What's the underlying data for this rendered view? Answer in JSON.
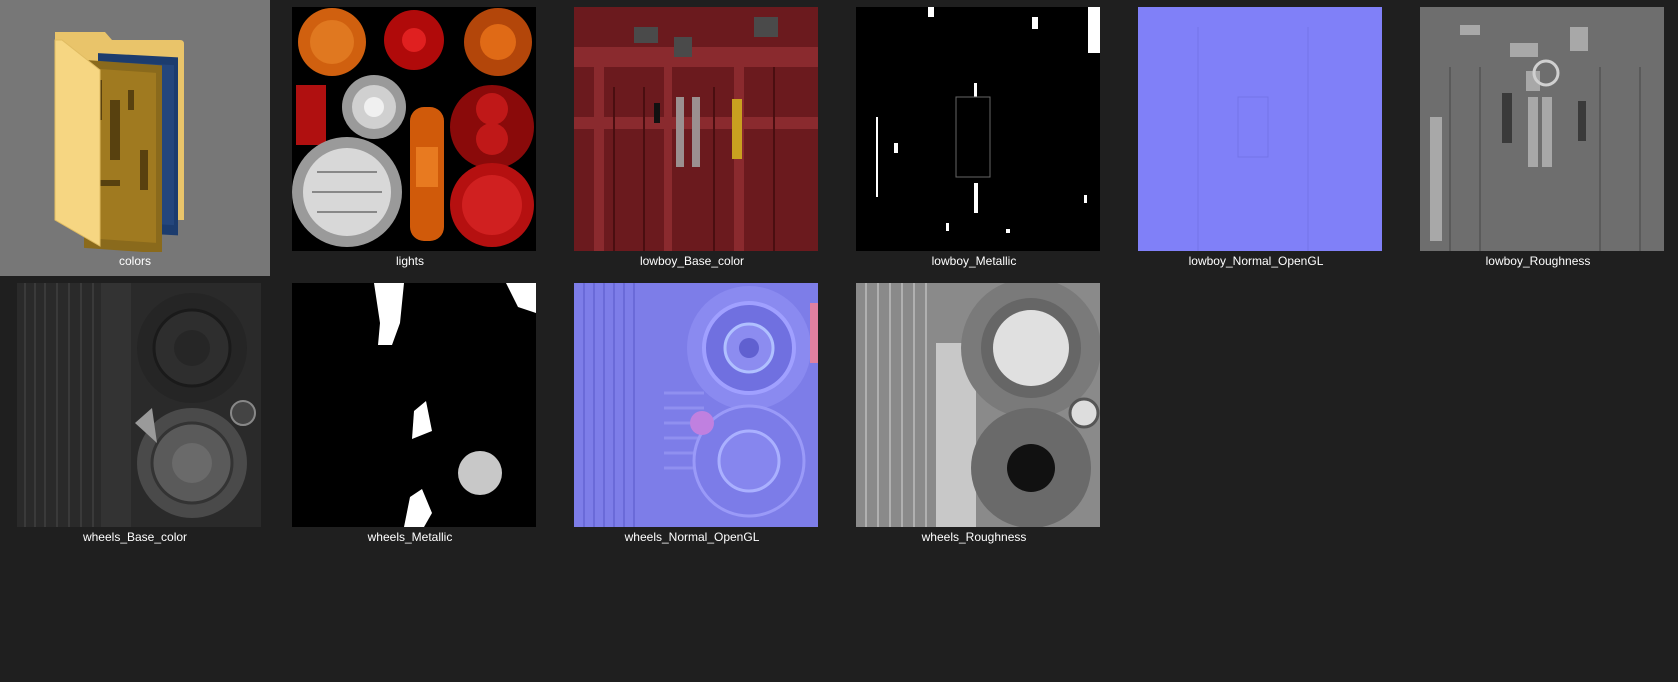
{
  "explorer": {
    "items": [
      {
        "name": "colors",
        "kind": "folder",
        "selected": true,
        "icon": "folder-icon"
      },
      {
        "name": "lights",
        "kind": "image",
        "icon": "texture-thumbnail"
      },
      {
        "name": "lowboy_Base_color",
        "kind": "image",
        "icon": "texture-thumbnail"
      },
      {
        "name": "lowboy_Metallic",
        "kind": "image",
        "icon": "texture-thumbnail"
      },
      {
        "name": "lowboy_Normal_OpenGL",
        "kind": "image",
        "icon": "texture-thumbnail"
      },
      {
        "name": "lowboy_Roughness",
        "kind": "image",
        "icon": "texture-thumbnail"
      },
      {
        "name": "wheels_Base_color",
        "kind": "image",
        "icon": "texture-thumbnail"
      },
      {
        "name": "wheels_Metallic",
        "kind": "image",
        "icon": "texture-thumbnail"
      },
      {
        "name": "wheels_Normal_OpenGL",
        "kind": "image",
        "icon": "texture-thumbnail"
      },
      {
        "name": "wheels_Roughness",
        "kind": "image",
        "icon": "texture-thumbnail"
      }
    ]
  },
  "colors": {
    "background": "#1f1f1f",
    "selection": "#777777",
    "label": "#ffffff"
  }
}
